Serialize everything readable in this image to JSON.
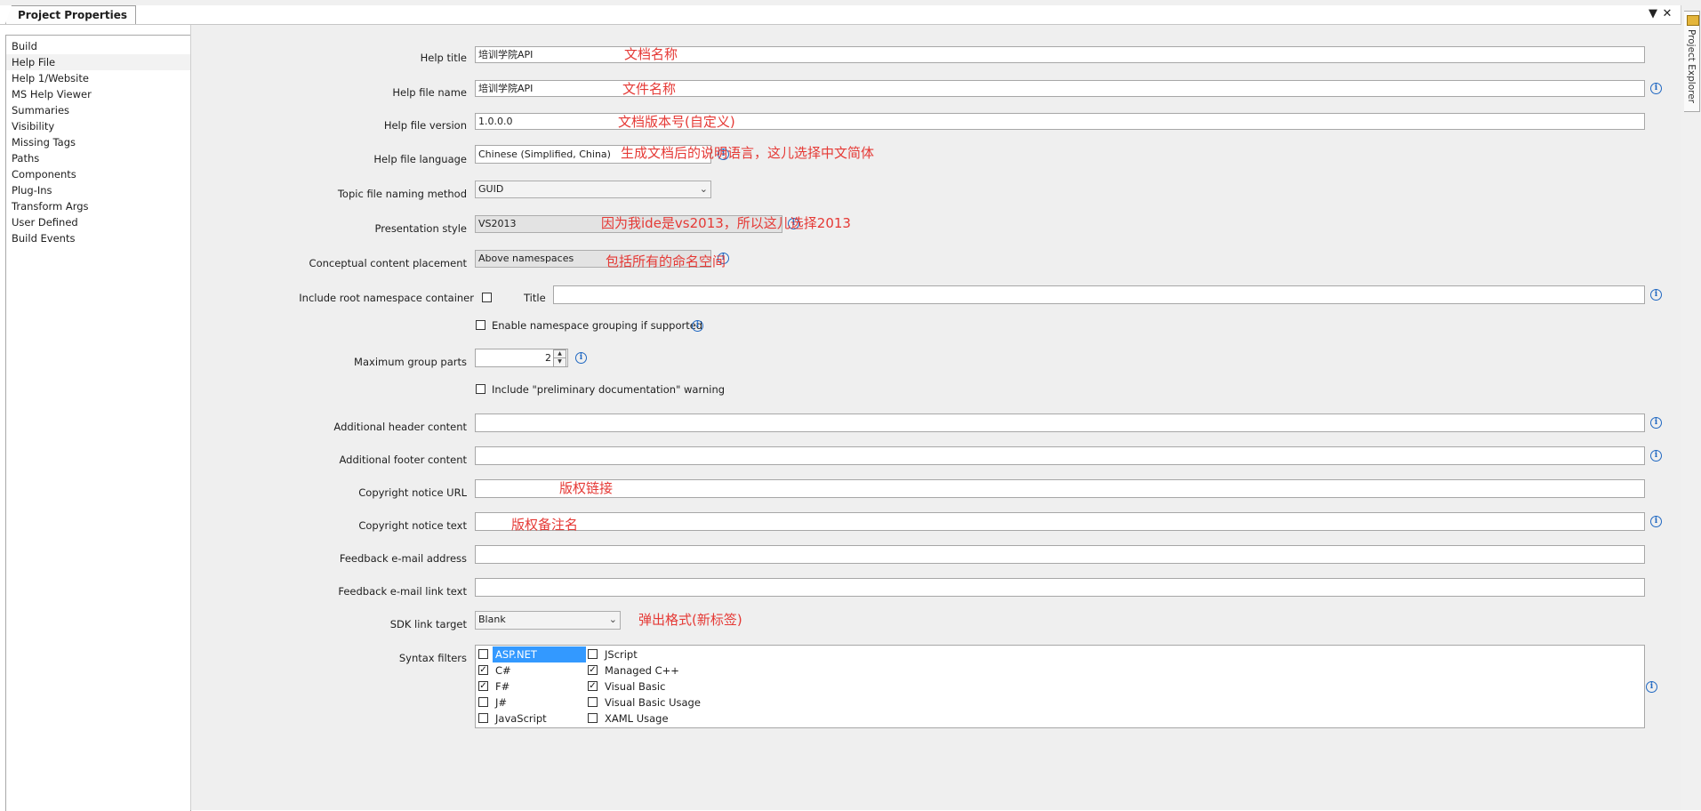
{
  "tab": {
    "title": "Project Properties"
  },
  "window_controls": {
    "dropdown_glyph": "▼",
    "close_glyph": "✕"
  },
  "side_panel": {
    "label": "Project Explorer"
  },
  "nav": {
    "items": [
      {
        "label": "Build"
      },
      {
        "label": "Help File",
        "selected": true
      },
      {
        "label": "Help 1/Website"
      },
      {
        "label": "MS Help Viewer"
      },
      {
        "label": "Summaries"
      },
      {
        "label": "Visibility"
      },
      {
        "label": "Missing Tags"
      },
      {
        "label": "Paths"
      },
      {
        "label": "Components"
      },
      {
        "label": "Plug-Ins"
      },
      {
        "label": "Transform Args"
      },
      {
        "label": "User Defined"
      },
      {
        "label": "Build Events"
      }
    ]
  },
  "form": {
    "help_title": {
      "label": "Help title",
      "value": "培训学院API"
    },
    "help_file_name": {
      "label": "Help file name",
      "value": "培训学院API"
    },
    "help_file_version": {
      "label": "Help file version",
      "value": "1.0.0.0"
    },
    "help_file_language": {
      "label": "Help file language",
      "value": "Chinese (Simplified, China)"
    },
    "topic_naming": {
      "label": "Topic file naming method",
      "value": "GUID"
    },
    "presentation_style": {
      "label": "Presentation style",
      "value": "VS2013"
    },
    "content_placement": {
      "label": "Conceptual content placement",
      "value": "Above namespaces"
    },
    "root_namespace": {
      "label": "Include root namespace container",
      "checked": false,
      "title_label": "Title",
      "title_value": ""
    },
    "namespace_grouping": {
      "label": "Enable namespace grouping if supported",
      "checked": false
    },
    "max_group_parts": {
      "label": "Maximum group parts",
      "value": "2"
    },
    "preliminary": {
      "label": "Include \"preliminary documentation\" warning",
      "checked": false
    },
    "header_content": {
      "label": "Additional header content",
      "value": ""
    },
    "footer_content": {
      "label": "Additional footer content",
      "value": ""
    },
    "copyright_url": {
      "label": "Copyright notice URL",
      "value": ""
    },
    "copyright_text": {
      "label": "Copyright notice text",
      "value": ""
    },
    "feedback_email": {
      "label": "Feedback e-mail address",
      "value": ""
    },
    "feedback_link": {
      "label": "Feedback e-mail link text",
      "value": ""
    },
    "sdk_link_target": {
      "label": "SDK link target",
      "value": "Blank"
    },
    "syntax_filters": {
      "label": "Syntax filters",
      "items": [
        {
          "label": "ASP.NET",
          "checked": false,
          "selected": true
        },
        {
          "label": "C#",
          "checked": true
        },
        {
          "label": "F#",
          "checked": true
        },
        {
          "label": "J#",
          "checked": false
        },
        {
          "label": "JavaScript",
          "checked": false
        },
        {
          "label": "JScript",
          "checked": false
        },
        {
          "label": "Managed C++",
          "checked": true
        },
        {
          "label": "Visual Basic",
          "checked": true
        },
        {
          "label": "Visual Basic Usage",
          "checked": false
        },
        {
          "label": "XAML Usage",
          "checked": false
        }
      ]
    }
  },
  "annotations": {
    "doc_name": "文档名称",
    "file_name": "文件名称",
    "doc_version": "文档版本号(自定义)",
    "language": "生成文档后的说明语言，这儿选择中文简体",
    "style": "因为我ide是vs2013，所以这儿选择2013",
    "placement": "包括所有的命名空间",
    "copyright_link": "版权链接",
    "copyright_note": "版权备注名",
    "popup_format": "弹出格式(新标签)"
  },
  "colors": {
    "annotation": "#e53935",
    "info_icon": "#2068c2",
    "selection": "#3399ff",
    "panel_bg": "#efefef"
  },
  "icons": {
    "info": "info-icon",
    "dropdown": "chevron-down-icon",
    "checkbox_checked": "check-icon"
  }
}
